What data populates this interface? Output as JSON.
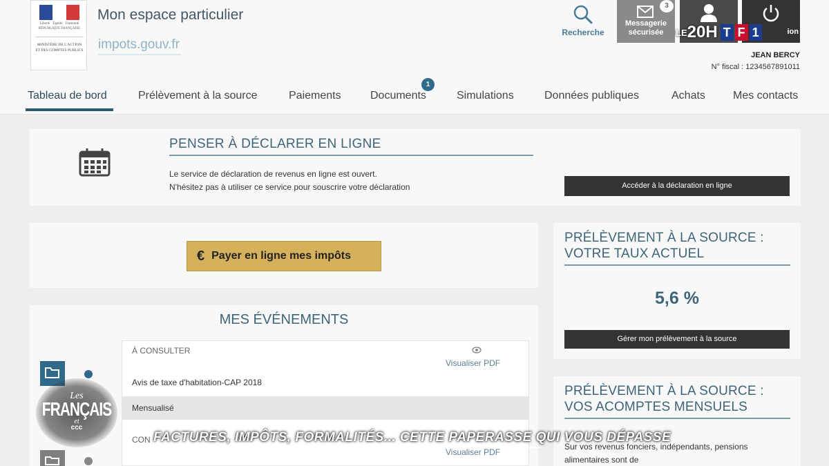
{
  "header": {
    "logo_mini": "Liberté · Égalité · Fraternité RÉPUBLIQUE FRANÇAISE",
    "logo_ministry": "Ministère de l'action et des comptes publics",
    "title": "Mon espace particulier",
    "domain": "impots.gouv.fr",
    "search_label": "Recherche",
    "messaging_label_1": "Messagerie",
    "messaging_label_2": "sécurisée",
    "messaging_count": "3",
    "logout_label": "ion",
    "user_name": "JEAN BERCY",
    "fiscal_number": "N° fiscal : 1234567891011"
  },
  "nav": {
    "items": [
      {
        "label": "Tableau de bord"
      },
      {
        "label": "Prélèvement à la source"
      },
      {
        "label": "Paiements"
      },
      {
        "label": "Documents"
      },
      {
        "label": "Simulations"
      },
      {
        "label": "Données publiques"
      },
      {
        "label": "Achats"
      },
      {
        "label": "Mes contacts"
      }
    ],
    "documents_badge": "1"
  },
  "declare": {
    "title": "PENSER À DÉCLARER EN LIGNE",
    "line1": "Le service de déclaration de revenus en ligne est ouvert.",
    "line2": "N'hésitez pas à utiliser ce service pour souscrire votre déclaration",
    "button": "Accéder à la déclaration en ligne"
  },
  "pay": {
    "symbol": "€",
    "button": "Payer en ligne mes impôts"
  },
  "taux": {
    "title": "PRÉLÈVEMENT À LA SOURCE : VOTRE TAUX ACTUEL",
    "value": "5,6 %",
    "button": "Gérer mon prélèvement à la source"
  },
  "events": {
    "title": "MES ÉVÉNEMENTS",
    "status": "À CONSULTER",
    "view_label": "Visualiser  PDF",
    "doc_name": "Avis de taxe d'habitation-CAP 2018",
    "mensualise": "Mensualisé",
    "status2": "CON",
    "view_label2": "Visualiser  PDF"
  },
  "acomptes": {
    "title": "PRÉLÈVEMENT À LA SOURCE : VOS ACOMPTES MENSUELS",
    "text": "Sur vos revenus fonciers, indépendants, pensions alimentaires     sont de"
  },
  "overlay": {
    "channel_le": "LE",
    "channel_20h": "20H",
    "channel_t": "T",
    "channel_f": "F",
    "channel_1": "1",
    "show_les": "Les",
    "show_francais": "FRANÇAIS",
    "show_et": "et",
    "show_ccc": "ccc",
    "banner": "FACTURES, IMPÔTS, FORMALITÉS...  CETTE PAPERASSE QUI VOUS DÉPASSE"
  },
  "colors": {
    "primary": "#2f6a8a",
    "title_blue": "#3e6478",
    "pay_gold": "#d4b15a",
    "dark_button": "#333333"
  }
}
